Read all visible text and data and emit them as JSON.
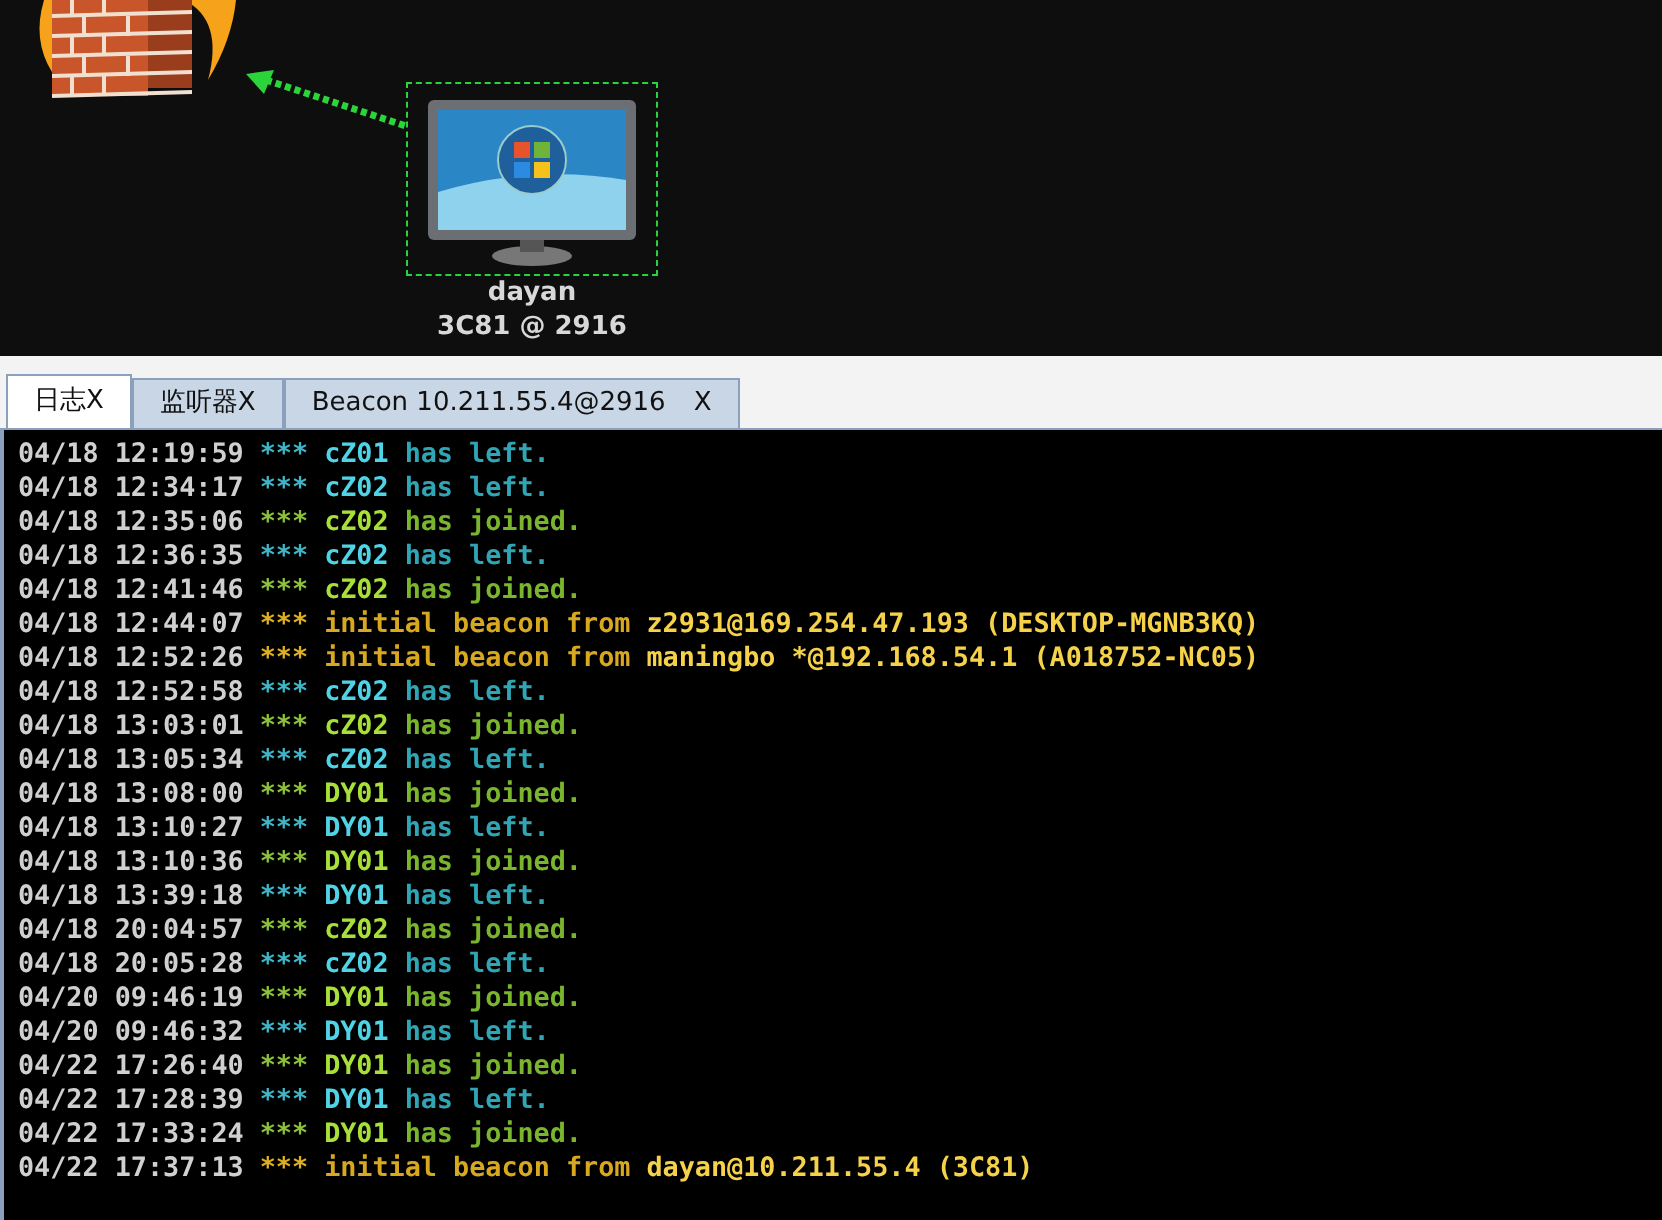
{
  "graph": {
    "nodes": [
      {
        "kind": "firewall"
      },
      {
        "kind": "host",
        "selected": true,
        "name": "dayan",
        "detail": "3C81 @ 2916"
      }
    ]
  },
  "tabs": [
    {
      "label": "日志",
      "close": "X",
      "selected": true
    },
    {
      "label": "监听器",
      "close": "X",
      "selected": false
    },
    {
      "label": "Beacon 10.211.55.4@2916",
      "close": "X",
      "selected": false
    }
  ],
  "log": [
    {
      "time": "04/18 12:19:59",
      "marker": "***",
      "kind": "left",
      "subject": "cZ01",
      "text": "has left."
    },
    {
      "time": "04/18 12:34:17",
      "marker": "***",
      "kind": "left",
      "subject": "cZ02",
      "text": "has left."
    },
    {
      "time": "04/18 12:35:06",
      "marker": "***",
      "kind": "joined",
      "subject": "cZ02",
      "text": "has joined."
    },
    {
      "time": "04/18 12:36:35",
      "marker": "***",
      "kind": "left",
      "subject": "cZ02",
      "text": "has left."
    },
    {
      "time": "04/18 12:41:46",
      "marker": "***",
      "kind": "joined",
      "subject": "cZ02",
      "text": "has joined."
    },
    {
      "time": "04/18 12:44:07",
      "marker": "***",
      "kind": "beacon",
      "subject": "z2931@169.254.47.193 (DESKTOP-MGNB3KQ)",
      "text": "initial beacon from"
    },
    {
      "time": "04/18 12:52:26",
      "marker": "***",
      "kind": "beacon",
      "subject": "maningbo *@192.168.54.1 (A018752-NC05)",
      "text": "initial beacon from"
    },
    {
      "time": "04/18 12:52:58",
      "marker": "***",
      "kind": "left",
      "subject": "cZ02",
      "text": "has left."
    },
    {
      "time": "04/18 13:03:01",
      "marker": "***",
      "kind": "joined",
      "subject": "cZ02",
      "text": "has joined."
    },
    {
      "time": "04/18 13:05:34",
      "marker": "***",
      "kind": "left",
      "subject": "cZ02",
      "text": "has left."
    },
    {
      "time": "04/18 13:08:00",
      "marker": "***",
      "kind": "joined",
      "subject": "DY01",
      "text": "has joined."
    },
    {
      "time": "04/18 13:10:27",
      "marker": "***",
      "kind": "left",
      "subject": "DY01",
      "text": "has left."
    },
    {
      "time": "04/18 13:10:36",
      "marker": "***",
      "kind": "joined",
      "subject": "DY01",
      "text": "has joined."
    },
    {
      "time": "04/18 13:39:18",
      "marker": "***",
      "kind": "left",
      "subject": "DY01",
      "text": "has left."
    },
    {
      "time": "04/18 20:04:57",
      "marker": "***",
      "kind": "joined",
      "subject": "cZ02",
      "text": "has joined."
    },
    {
      "time": "04/18 20:05:28",
      "marker": "***",
      "kind": "left",
      "subject": "cZ02",
      "text": "has left."
    },
    {
      "time": "04/20 09:46:19",
      "marker": "***",
      "kind": "joined",
      "subject": "DY01",
      "text": "has joined."
    },
    {
      "time": "04/20 09:46:32",
      "marker": "***",
      "kind": "left",
      "subject": "DY01",
      "text": "has left."
    },
    {
      "time": "04/22 17:26:40",
      "marker": "***",
      "kind": "joined",
      "subject": "DY01",
      "text": "has joined."
    },
    {
      "time": "04/22 17:28:39",
      "marker": "***",
      "kind": "left",
      "subject": "DY01",
      "text": "has left."
    },
    {
      "time": "04/22 17:33:24",
      "marker": "***",
      "kind": "joined",
      "subject": "DY01",
      "text": "has joined."
    },
    {
      "time": "04/22 17:37:13",
      "marker": "***",
      "kind": "beacon",
      "subject": "dayan@10.211.55.4 (3C81)",
      "text": "initial beacon from"
    }
  ]
}
